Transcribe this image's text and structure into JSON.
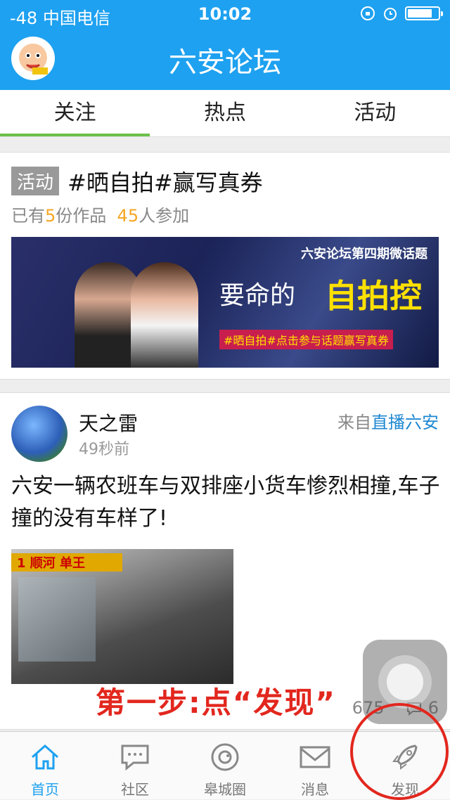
{
  "status": {
    "carrier": "-48 中国电信",
    "time": "10:02"
  },
  "header": {
    "title": "六安论坛"
  },
  "tabs": [
    {
      "label": "关注"
    },
    {
      "label": "热点"
    },
    {
      "label": "活动"
    }
  ],
  "activity": {
    "badge": "活动",
    "title": "#晒自拍#赢写真券",
    "meta_pre": "已有",
    "works": "5",
    "meta_mid": "份作品",
    "participants": "45",
    "meta_post": "人参加",
    "banner": {
      "top_text": "六安论坛第四期微话题",
      "slogan_a": "要命的",
      "slogan_b": "自拍控",
      "sub": "#晒自拍#点击参与话题赢写真券"
    }
  },
  "post": {
    "author": "天之雷",
    "time": "49秒前",
    "from_prefix": "来自",
    "from_link": "直播六安",
    "text": "六安一辆农班车与双排座小货车惨烈相撞,车子撞的没有车样了!",
    "image_text": "1 顺河 单王",
    "views": "675",
    "comments": "6"
  },
  "annotation": {
    "step_text": "第一步:点“发现”"
  },
  "tabbar": [
    {
      "label": "首页",
      "icon": "home-icon"
    },
    {
      "label": "社区",
      "icon": "chat-bubble-icon"
    },
    {
      "label": "皋城圈",
      "icon": "camera-circle-icon"
    },
    {
      "label": "消息",
      "icon": "envelope-icon"
    },
    {
      "label": "发现",
      "icon": "rocket-icon"
    }
  ],
  "colors": {
    "brand": "#1ea1f0",
    "tab_indicator": "#6cc04a",
    "accent": "#f5a623",
    "annotation": "#e2271e"
  }
}
